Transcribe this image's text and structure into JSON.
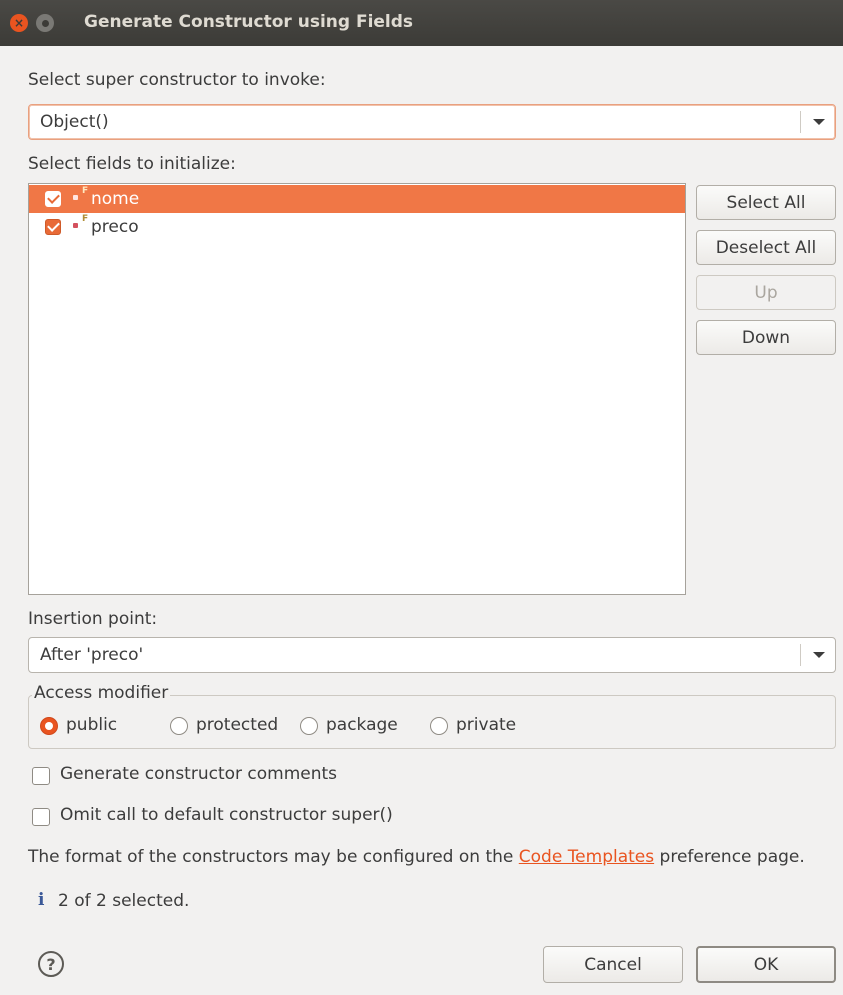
{
  "window": {
    "title": "Generate Constructor using Fields",
    "close_glyph": "×"
  },
  "super_constructor": {
    "label": "Select super constructor to invoke:",
    "selected": "Object()"
  },
  "fields": {
    "label": "Select fields to initialize:",
    "items": [
      {
        "name": "nome",
        "final_mark": "F",
        "checked": true,
        "selected": true
      },
      {
        "name": "preco",
        "final_mark": "F",
        "checked": true,
        "selected": false
      }
    ]
  },
  "side_buttons": {
    "select_all": "Select All",
    "deselect_all": "Deselect All",
    "up": "Up",
    "down": "Down"
  },
  "insertion_point": {
    "label": "Insertion point:",
    "selected": "After 'preco'"
  },
  "access_modifier": {
    "title": "Access modifier",
    "options": [
      {
        "label": "public",
        "selected": true
      },
      {
        "label": "protected",
        "selected": false
      },
      {
        "label": "package",
        "selected": false
      },
      {
        "label": "private",
        "selected": false
      }
    ]
  },
  "options": {
    "generate_comments": "Generate constructor comments",
    "omit_super": "Omit call to default constructor super()"
  },
  "format_note": {
    "before": "The format of the constructors may be configured on the",
    "link": "Code Templates",
    "after": "preference page."
  },
  "status": {
    "info_glyph": "i",
    "text": "2 of 2 selected."
  },
  "footer": {
    "help_glyph": "?",
    "cancel": "Cancel",
    "ok": "OK"
  },
  "colors": {
    "accent": "#e95420",
    "selection": "#f07746",
    "titlebar": "#3c3b37",
    "background": "#f2f1f0"
  }
}
